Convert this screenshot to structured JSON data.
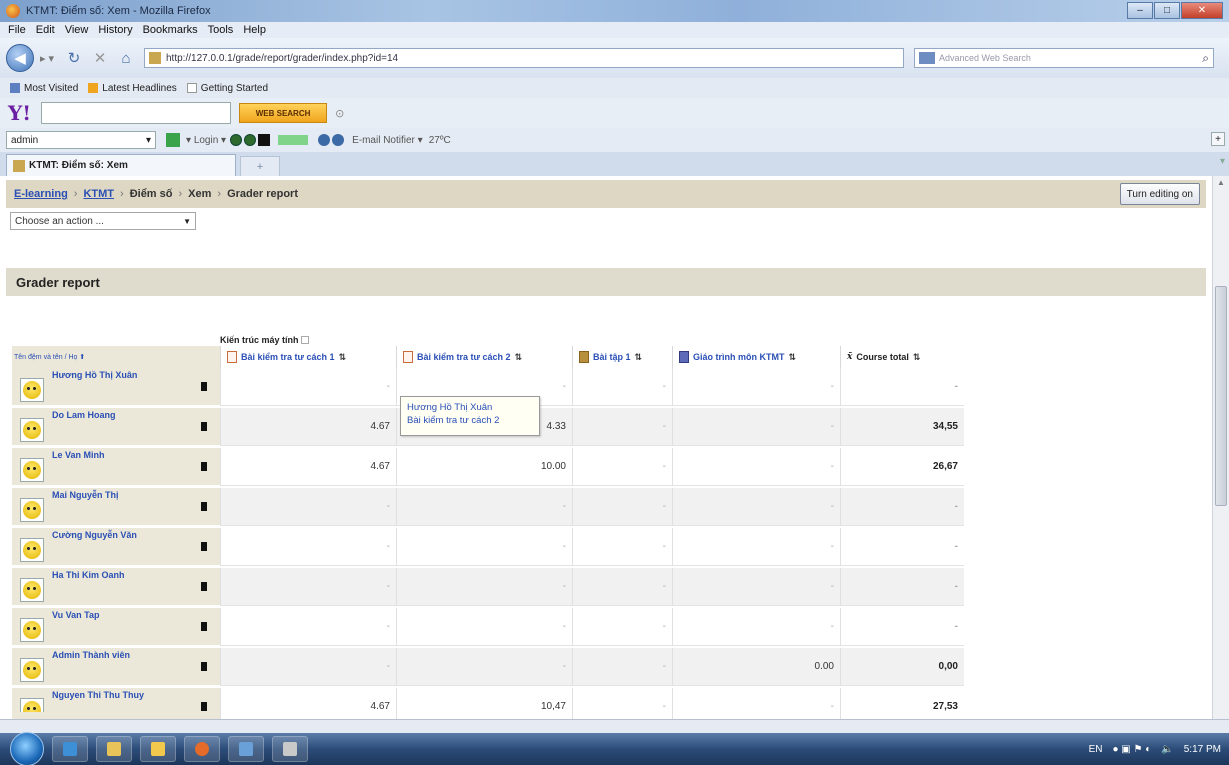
{
  "window": {
    "title": "KTMT: Điểm số: Xem - Mozilla Firefox"
  },
  "menu": [
    "File",
    "Edit",
    "View",
    "History",
    "Bookmarks",
    "Tools",
    "Help"
  ],
  "navbar": {
    "url": "http://127.0.0.1/grade/report/grader/index.php?id=14",
    "search_placeholder": "Advanced Web Search"
  },
  "bookmarks": [
    "Most Visited",
    "Latest Headlines",
    "Getting Started"
  ],
  "yahoo": {
    "logo": "Y!",
    "web_search": "WEB SEARCH"
  },
  "toolbar": {
    "user": "admin",
    "login": "Login",
    "email_notifier": "E-mail Notifier",
    "temperature": "27ºC"
  },
  "tab": {
    "label": "KTMT: Điểm số: Xem"
  },
  "breadcrumb": {
    "elearning": "E-learning",
    "course": "KTMT",
    "grades": "Điểm số",
    "view": "Xem",
    "current": "Grader report",
    "turn_editing": "Turn editing on"
  },
  "action_select": {
    "value": "Choose an action ..."
  },
  "report": {
    "title": "Grader report",
    "category": "Kiến trúc máy tính",
    "name_header": "Tên đệm và tên / Họ",
    "columns": [
      {
        "label": "Bài kiểm tra tư cách 1",
        "icon": "quiz-icon"
      },
      {
        "label": "Bài kiểm tra tư cách 2",
        "icon": "quiz-icon"
      },
      {
        "label": "Bài tập 1",
        "icon": "assignment-icon"
      },
      {
        "label": "Giáo trình môn KTMT",
        "icon": "resource-icon"
      },
      {
        "label": "Course total",
        "icon": "sigma-icon"
      }
    ],
    "rows": [
      {
        "name": "Hương Hồ Thị Xuân",
        "grades": [
          "-",
          "-",
          "-",
          "-",
          "-"
        ]
      },
      {
        "name": "Do Lam Hoang",
        "grades": [
          "4.67",
          "4.33",
          "-",
          "-",
          "34,55"
        ]
      },
      {
        "name": "Le Van Minh",
        "grades": [
          "4.67",
          "10.00",
          "-",
          "-",
          "26,67"
        ]
      },
      {
        "name": "Mai Nguyễn Thị",
        "grades": [
          "-",
          "-",
          "-",
          "-",
          "-"
        ]
      },
      {
        "name": "Cường Nguyễn Văn",
        "grades": [
          "-",
          "-",
          "-",
          "-",
          "-"
        ]
      },
      {
        "name": "Ha Thi Kim Oanh",
        "grades": [
          "-",
          "-",
          "-",
          "-",
          "-"
        ]
      },
      {
        "name": "Vu Van Tap",
        "grades": [
          "-",
          "-",
          "-",
          "-",
          "-"
        ]
      },
      {
        "name": "Admin Thành viên",
        "grades": [
          "-",
          "-",
          "-",
          "0.00",
          "0,00"
        ]
      },
      {
        "name": "Nguyen Thi Thu Thuy",
        "grades": [
          "4.67",
          "10,47",
          "-",
          "-",
          "27,53"
        ]
      }
    ],
    "tooltip": {
      "line1": "Hương Hồ Thị Xuân",
      "line2": "Bài kiểm tra tư cách 2"
    }
  },
  "taskbar": {
    "language": "EN",
    "clock": "5:17 PM"
  }
}
